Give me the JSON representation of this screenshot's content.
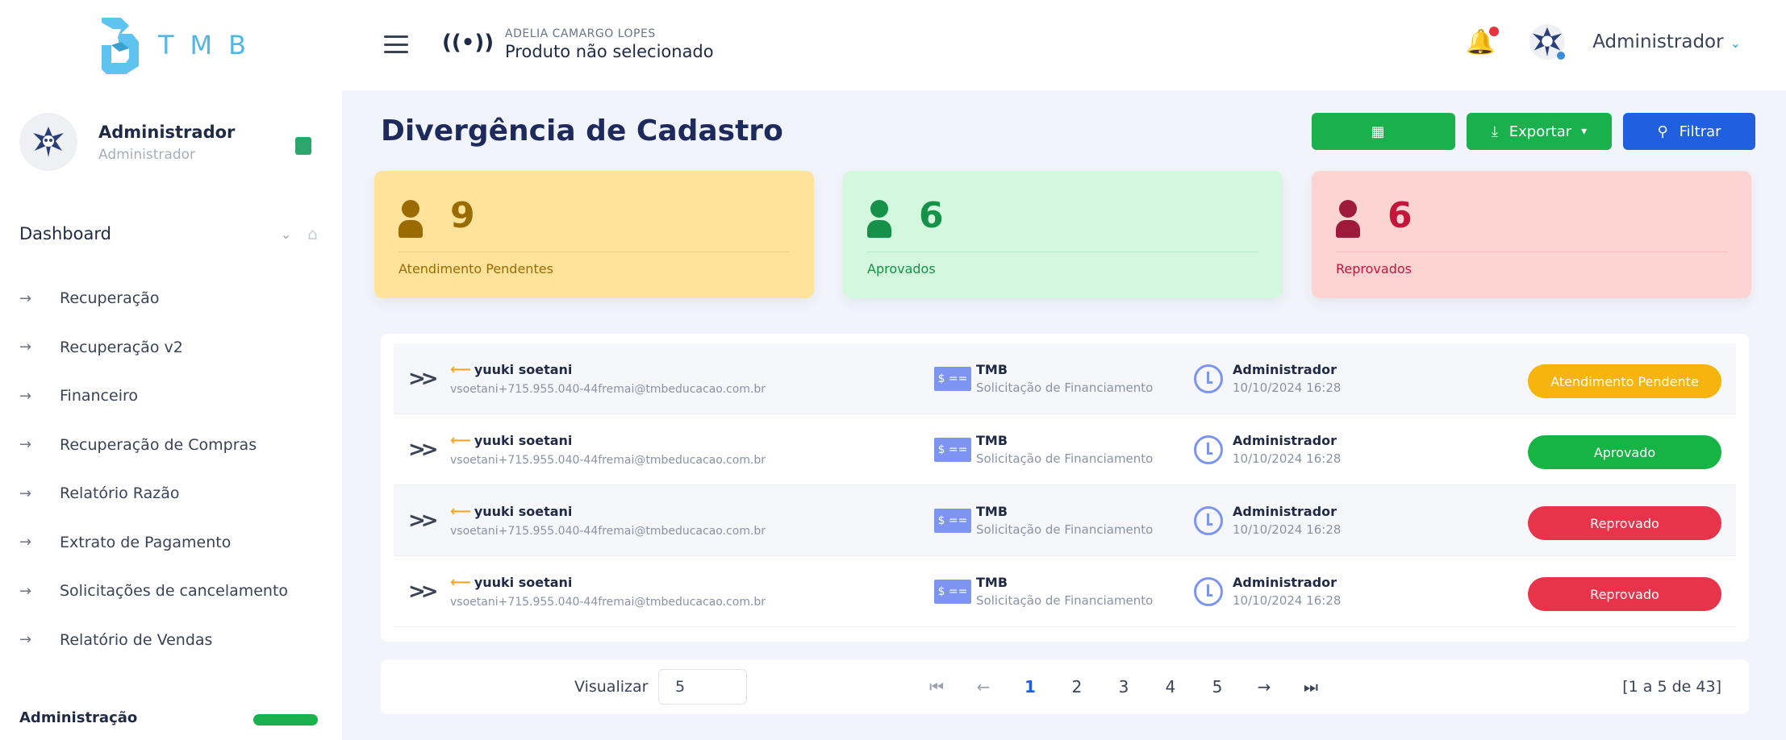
{
  "brand": {
    "logo_text": "TMB"
  },
  "sidebar": {
    "user_name": "Administrador",
    "user_role": "Administrador",
    "section_title": "Dashboard",
    "items": [
      {
        "label": "Recuperação"
      },
      {
        "label": "Recuperação v2"
      },
      {
        "label": "Financeiro"
      },
      {
        "label": "Recuperação de Compras"
      },
      {
        "label": "Relatório Razão"
      },
      {
        "label": "Extrato de Pagamento"
      },
      {
        "label": "Solicitações de cancelamento"
      },
      {
        "label": "Relatório de Vendas"
      }
    ],
    "footer_partial": "Administração"
  },
  "topbar": {
    "agent_name": "ADELIA CAMARGO LOPES",
    "product": "Produto não selecionado",
    "user": "Administrador"
  },
  "main": {
    "title": "Divergência de Cadastro",
    "buttons": {
      "export": "Exportar",
      "filter": "Filtrar"
    },
    "cards": [
      {
        "count": "9",
        "label": "Atendimento Pendentes"
      },
      {
        "count": "6",
        "label": "Aprovados"
      },
      {
        "count": "6",
        "label": "Reprovados"
      }
    ],
    "rows": [
      {
        "name": "yuuki soetani",
        "email": "vsoetani+715.955.040-44fremai@tmbeducacao.com.br",
        "product": "TMB",
        "product_type": "Solicitação de Financiamento",
        "responsible": "Administrador",
        "date": "10/10/2024 16:28",
        "status": "Atendimento Pendente",
        "status_kind": "pending"
      },
      {
        "name": "yuuki soetani",
        "email": "vsoetani+715.955.040-44fremai@tmbeducacao.com.br",
        "product": "TMB",
        "product_type": "Solicitação de Financiamento",
        "responsible": "Administrador",
        "date": "10/10/2024 16:28",
        "status": "Aprovado",
        "status_kind": "approved"
      },
      {
        "name": "yuuki soetani",
        "email": "vsoetani+715.955.040-44fremai@tmbeducacao.com.br",
        "product": "TMB",
        "product_type": "Solicitação de Financiamento",
        "responsible": "Administrador",
        "date": "10/10/2024 16:28",
        "status": "Reprovado",
        "status_kind": "rejected"
      },
      {
        "name": "yuuki soetani",
        "email": "vsoetani+715.955.040-44fremai@tmbeducacao.com.br",
        "product": "TMB",
        "product_type": "Solicitação de Financiamento",
        "responsible": "Administrador",
        "date": "10/10/2024 16:28",
        "status": "Reprovado",
        "status_kind": "rejected"
      }
    ],
    "pager": {
      "visualizar_label": "Visualizar",
      "page_size": "5",
      "pages": [
        "1",
        "2",
        "3",
        "4",
        "5"
      ],
      "current_page": "1",
      "total": "[1 a 5 de 43]"
    }
  },
  "colors": {
    "accent": "#1f5fe0",
    "success": "#19b14b",
    "pending": "#f7b40c",
    "danger": "#e8344a",
    "brand": "#4fb8e8"
  }
}
